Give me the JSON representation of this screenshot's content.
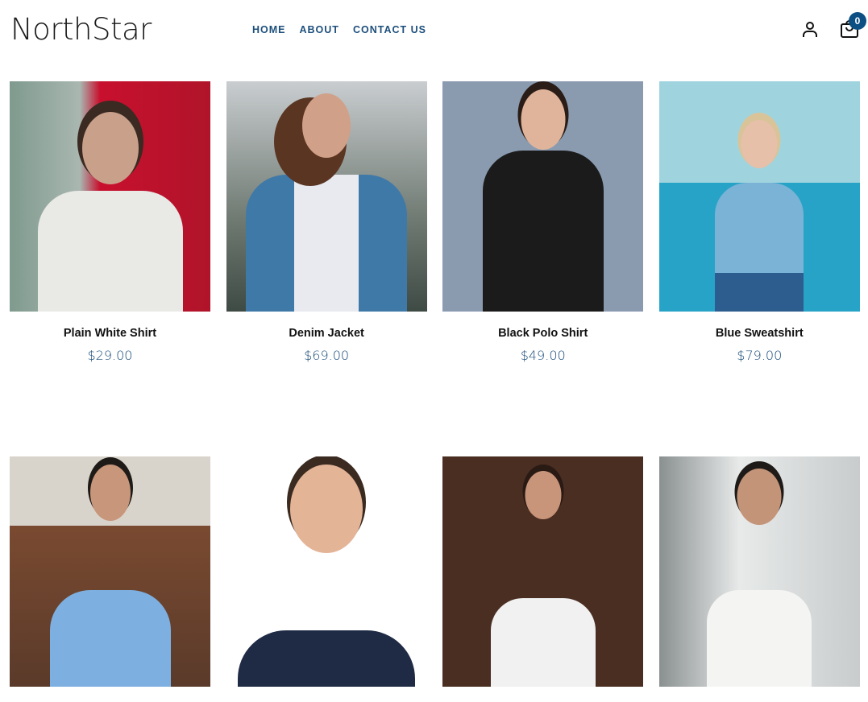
{
  "brand": "NorthStar",
  "nav": [
    "HOME",
    "ABOUT",
    "CONTACT US"
  ],
  "cart": {
    "count": "0"
  },
  "icons": {
    "account": "user-icon",
    "cart": "shopping-bag-icon"
  },
  "colors": {
    "accent": "#1d4f7c",
    "badge": "#0d4f82"
  },
  "products": [
    {
      "name": "Plain White Shirt",
      "price": "$29.00"
    },
    {
      "name": "Denim Jacket",
      "price": "$69.00"
    },
    {
      "name": "Black Polo Shirt",
      "price": "$49.00"
    },
    {
      "name": "Blue Sweatshirt",
      "price": "$79.00"
    },
    {
      "name": "",
      "price": ""
    },
    {
      "name": "",
      "price": ""
    },
    {
      "name": "",
      "price": ""
    },
    {
      "name": "",
      "price": ""
    }
  ]
}
